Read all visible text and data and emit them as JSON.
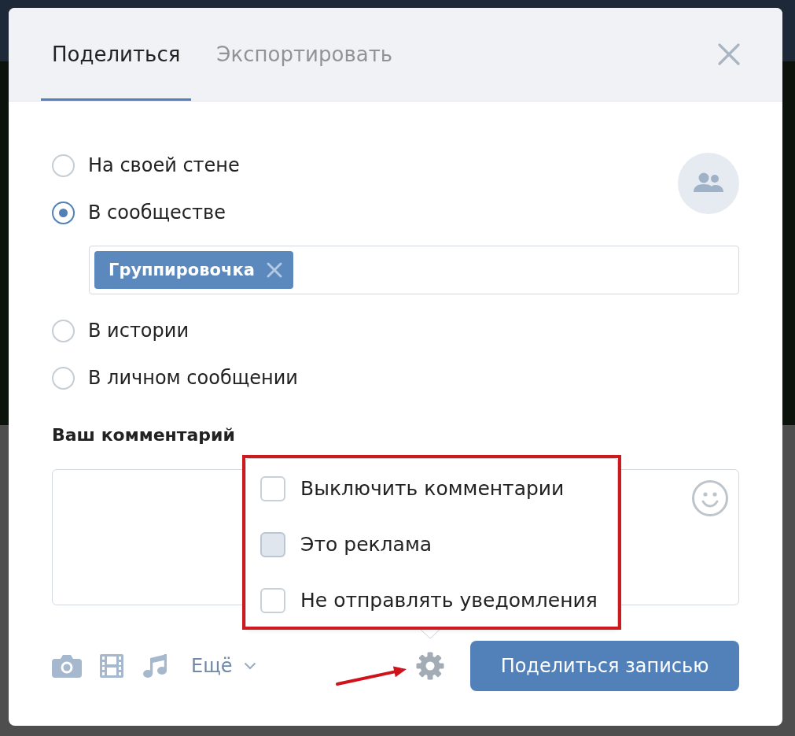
{
  "tabs": [
    {
      "label": "Поделиться",
      "selected": true
    },
    {
      "label": "Экспортировать",
      "selected": false
    }
  ],
  "share_targets": [
    {
      "label": "На своей стене",
      "selected": false
    },
    {
      "label": "В сообществе",
      "selected": true,
      "community_field": {
        "tags": [
          {
            "label": "Группировочка"
          }
        ]
      }
    },
    {
      "label": "В истории",
      "selected": false
    },
    {
      "label": "В личном сообщении",
      "selected": false
    }
  ],
  "comment": {
    "label": "Ваш комментарий"
  },
  "settings_menu": {
    "highlighted": true,
    "options": [
      {
        "label": "Выключить комментарии",
        "checked": false,
        "hovered": false
      },
      {
        "label": "Это реклама",
        "checked": false,
        "hovered": true
      },
      {
        "label": "Не отправлять уведомления",
        "checked": false,
        "hovered": false
      }
    ]
  },
  "toolbar": {
    "more_label": "Ещё"
  },
  "settings_button": {
    "pointed_by_arrow": true
  },
  "submit_button": {
    "label": "Поделиться записью"
  }
}
